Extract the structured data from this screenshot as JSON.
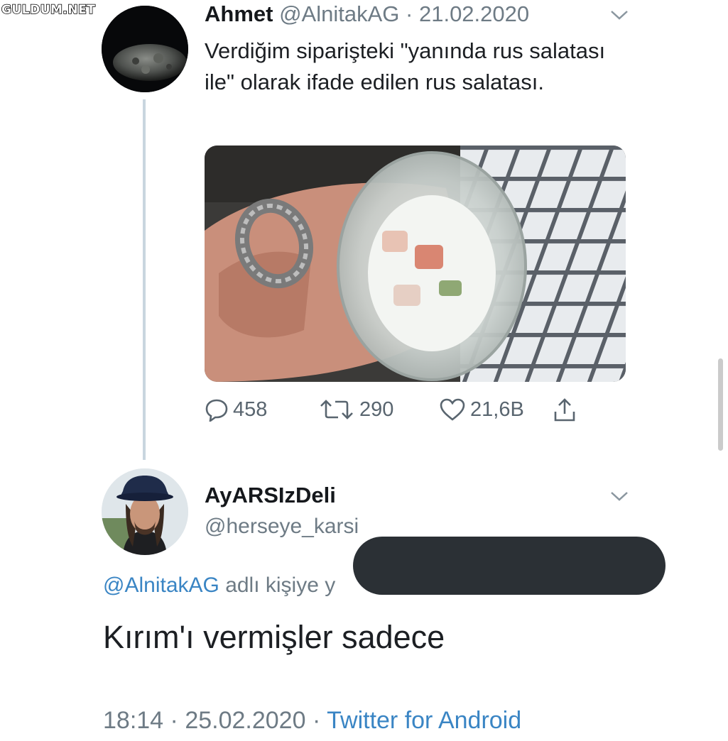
{
  "watermark": "GULDUM.NET",
  "tweet": {
    "author_name": "Ahmet",
    "handle": "@AlnitakAG",
    "separator": "·",
    "date": "21.02.2020",
    "text": "Verdiğim siparişteki \"yanında rus salatası ile\" olarak ifade edilen rus salatası.",
    "avatar_icon": "moon-avatar-icon",
    "media_description_icon": "salad-container-photo",
    "stats": {
      "replies": "458",
      "retweets": "290",
      "likes": "21,6B"
    }
  },
  "reply": {
    "author_name": "AyARSIzDeli",
    "handle": "@herseye_karsi",
    "replying_to_mention": "@AlnitakAG",
    "replying_to_suffix": "adlı kişiye y",
    "text": "Kırım'ı vermişler sadece",
    "time": "18:14",
    "separator": "·",
    "date": "25.02.2020",
    "client": "Twitter for Android"
  },
  "colors": {
    "link": "#3a85c4",
    "muted": "#6e7b85",
    "thread_line": "#c9d6df",
    "redaction": "#2b3035"
  }
}
